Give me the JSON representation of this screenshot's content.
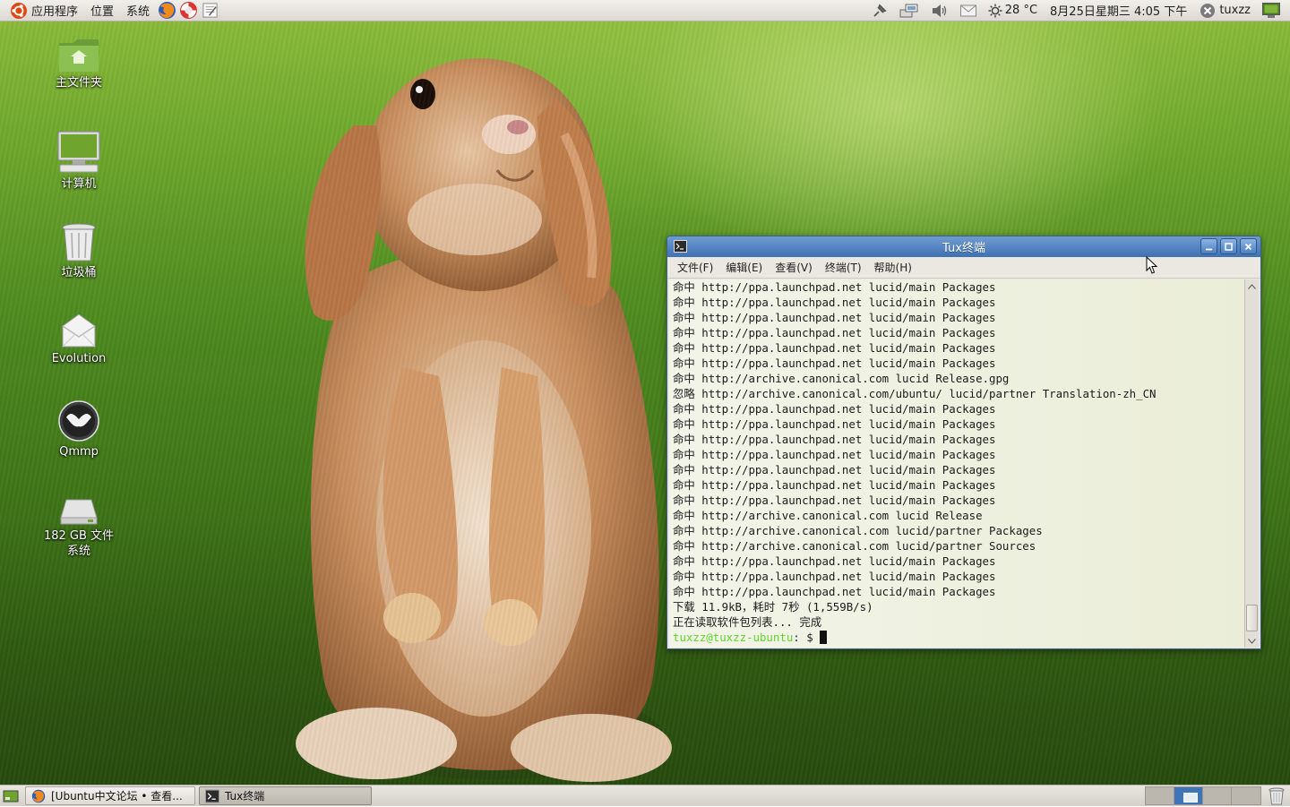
{
  "top_panel": {
    "menus": [
      "应用程序",
      "位置",
      "系统"
    ],
    "weather": "28 °C",
    "clock": "8月25日星期三 4:05 下午",
    "user": "tuxzz"
  },
  "desktop": {
    "icons": [
      {
        "label": "主文件夹",
        "icon": "home-folder-icon"
      },
      {
        "label": "计算机",
        "icon": "computer-icon"
      },
      {
        "label": "垃圾桶",
        "icon": "trash-icon"
      },
      {
        "label": "Evolution",
        "icon": "evolution-mail-icon"
      },
      {
        "label": "Qmmp",
        "icon": "qmmp-icon"
      },
      {
        "label": "182 GB 文件系统",
        "icon": "drive-icon"
      }
    ]
  },
  "terminal": {
    "title": "Tux终端",
    "menu": [
      "文件(F)",
      "编辑(E)",
      "查看(V)",
      "终端(T)",
      "帮助(H)"
    ],
    "lines": [
      "命中 http://ppa.launchpad.net lucid/main Packages",
      "命中 http://ppa.launchpad.net lucid/main Packages",
      "命中 http://ppa.launchpad.net lucid/main Packages",
      "命中 http://ppa.launchpad.net lucid/main Packages",
      "命中 http://ppa.launchpad.net lucid/main Packages",
      "命中 http://ppa.launchpad.net lucid/main Packages",
      "命中 http://archive.canonical.com lucid Release.gpg",
      "忽略 http://archive.canonical.com/ubuntu/ lucid/partner Translation-zh_CN",
      "命中 http://ppa.launchpad.net lucid/main Packages",
      "命中 http://ppa.launchpad.net lucid/main Packages",
      "命中 http://ppa.launchpad.net lucid/main Packages",
      "命中 http://ppa.launchpad.net lucid/main Packages",
      "命中 http://ppa.launchpad.net lucid/main Packages",
      "命中 http://ppa.launchpad.net lucid/main Packages",
      "命中 http://ppa.launchpad.net lucid/main Packages",
      "命中 http://archive.canonical.com lucid Release",
      "命中 http://archive.canonical.com lucid/partner Packages",
      "命中 http://archive.canonical.com lucid/partner Sources",
      "命中 http://ppa.launchpad.net lucid/main Packages",
      "命中 http://ppa.launchpad.net lucid/main Packages",
      "命中 http://ppa.launchpad.net lucid/main Packages",
      "下载 11.9kB，耗时 7秒 (1,559B/s)",
      "正在读取软件包列表... 完成"
    ],
    "prompt_user": "tuxzz@tuxzz-ubuntu",
    "prompt_suffix": ": $ "
  },
  "taskbar": {
    "tasks": [
      {
        "label": "[Ubuntu中文论坛 • 查看...",
        "icon": "firefox-icon"
      },
      {
        "label": "Tux终端",
        "icon": "terminal-icon"
      }
    ],
    "workspace_count": 4,
    "active_workspace": 2
  },
  "colors": {
    "titlebar": "#3f72b3",
    "prompt": "#5fd52b"
  }
}
